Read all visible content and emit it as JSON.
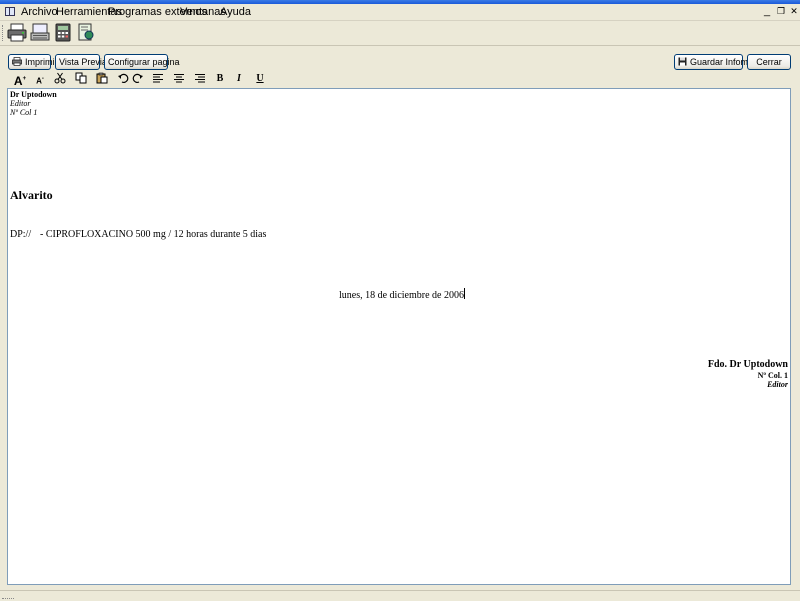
{
  "menu": {
    "items": [
      "Archivo",
      "Herramientas",
      "Programas externos",
      "Ventanas",
      "Ayuda"
    ],
    "minimize": "_",
    "restore": "❐",
    "close": "✕"
  },
  "toolbar_top": {
    "icons": [
      "printer-icon",
      "keyboard-icon",
      "calculator-icon",
      "document-icon"
    ]
  },
  "actions": {
    "print": "Imprimir",
    "preview": "Vista Previa",
    "page_setup": "Configurar pagina",
    "save_report": "Guardar Infome",
    "close": "Cerrar"
  },
  "format": {
    "grow": "A",
    "shrink": "A",
    "bold": "B",
    "italic": "I",
    "underline": "U"
  },
  "document": {
    "doctor_name": "Dr Uptodown",
    "doctor_role": "Editor",
    "doctor_col": "Nº Col 1",
    "patient": "Alvarito",
    "dp_label": "DP://",
    "prescription": "- CIPROFLOXACINO 500 mg / 12 horas durante 5 dias",
    "date": "lunes, 18 de diciembre de 2006",
    "sign_name": "Fdo. Dr Uptodown",
    "sign_col": "Nº Col. 1",
    "sign_role": "Editor"
  }
}
